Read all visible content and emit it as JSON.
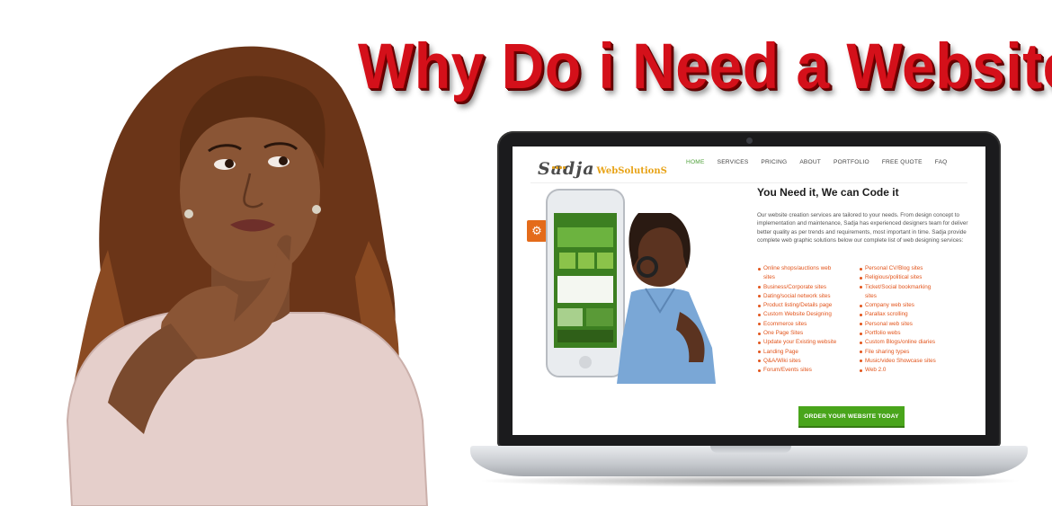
{
  "headline": "Why Do i Need a Website",
  "site": {
    "logo_mark": "Sadja",
    "logo_text": "WebSolutionS",
    "nav": [
      "HOME",
      "SERVICES",
      "PRICING",
      "ABOUT",
      "PORTFOLIO",
      "FREE QUOTE",
      "FAQ"
    ],
    "active_nav": "HOME",
    "section_title": "You Need it, We can Code it",
    "intro": "Our website creation services are tailored to your needs. From design concept to implementation and maintenance, Sadja has experienced designers team for deliver better quality as per trends and requirements, most important in time. Sadja provide complete web graphic solutions below our complete list of web designing services:",
    "services_col1": [
      "Online shops/auctions web",
      "sites",
      "Business/Corporate sites",
      "Dating/social network sites",
      "Product listing/Details page",
      "Custom Website Designing",
      "Ecommerce sites",
      "One Page Sites",
      "Update your Existing website",
      "Landing Page",
      "Q&A/Wiki sites",
      "Forum/Events sites"
    ],
    "services_col2": [
      "Personal CV/Blog sites",
      "Religious/political sites",
      "Ticket/Social bookmarking",
      "sites",
      "Company web sites",
      "Parallax scrolling",
      "Personal web sites",
      "Portfolio webs",
      "Custom Blogs/online diaries",
      "File sharing types",
      "Music/video Showcase sites",
      "Web 2.0"
    ],
    "cta_label": "ORDER YOUR WEBSITE TODAY",
    "gear_icon": "gear-icon"
  },
  "colors": {
    "headline_red": "#d4101a",
    "nav_active": "#4fa03a",
    "service_orange": "#e2541b",
    "cta_green": "#49a51b",
    "gear_orange": "#e46b1a"
  }
}
